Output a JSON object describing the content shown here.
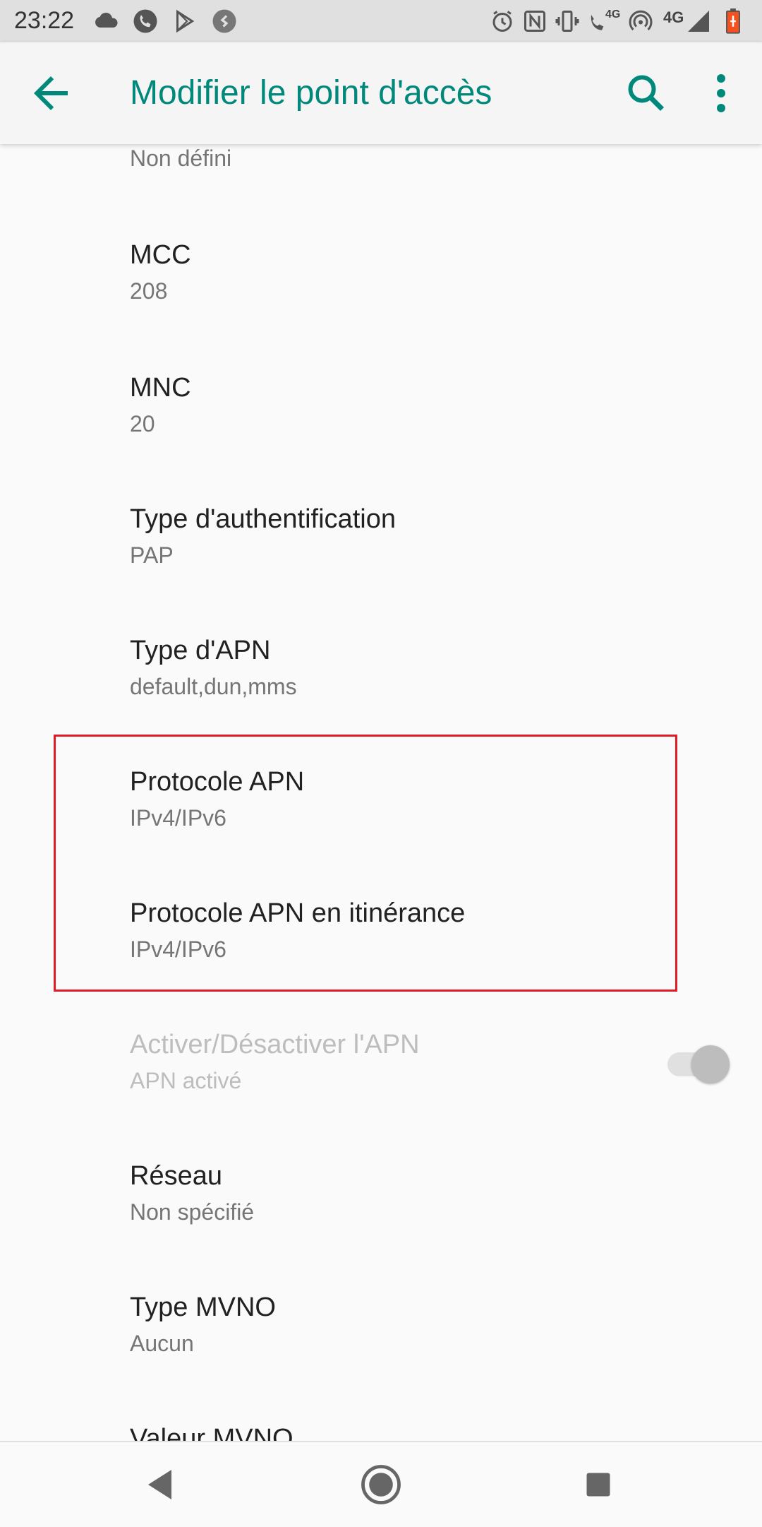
{
  "status_bar": {
    "time": "23:22",
    "network_label": "4G",
    "call_label": "4G",
    "left_icons": [
      "cloud-icon",
      "phone-icon",
      "play-store-icon",
      "shazam-icon"
    ],
    "right_icons": [
      "alarm-icon",
      "nfc-icon",
      "vibrate-icon",
      "volte-icon",
      "hotspot-icon",
      "signal-icon",
      "battery-icon"
    ]
  },
  "app_bar": {
    "title": "Modifier le point d'accès",
    "accent_color": "#00897b"
  },
  "preferences": [
    {
      "title": "",
      "summary": "Non défini"
    },
    {
      "title": "MCC",
      "summary": "208"
    },
    {
      "title": "MNC",
      "summary": "20"
    },
    {
      "title": "Type d'authentification",
      "summary": "PAP"
    },
    {
      "title": "Type d'APN",
      "summary": "default,dun,mms"
    },
    {
      "title": "Protocole APN",
      "summary": "IPv4/IPv6"
    },
    {
      "title": "Protocole APN en itinérance",
      "summary": "IPv4/IPv6"
    },
    {
      "title": "Activer/Désactiver l'APN",
      "summary": "APN activé",
      "enabled": false,
      "toggle": true
    },
    {
      "title": "Réseau",
      "summary": "Non spécifié"
    },
    {
      "title": "Type MVNO",
      "summary": "Aucun"
    },
    {
      "title": "Valeur MVNO",
      "summary": ""
    }
  ],
  "highlight_color": "#e01b24",
  "nav_bar": {
    "icons": [
      "back-triangle-icon",
      "home-circle-icon",
      "recents-square-icon"
    ]
  }
}
